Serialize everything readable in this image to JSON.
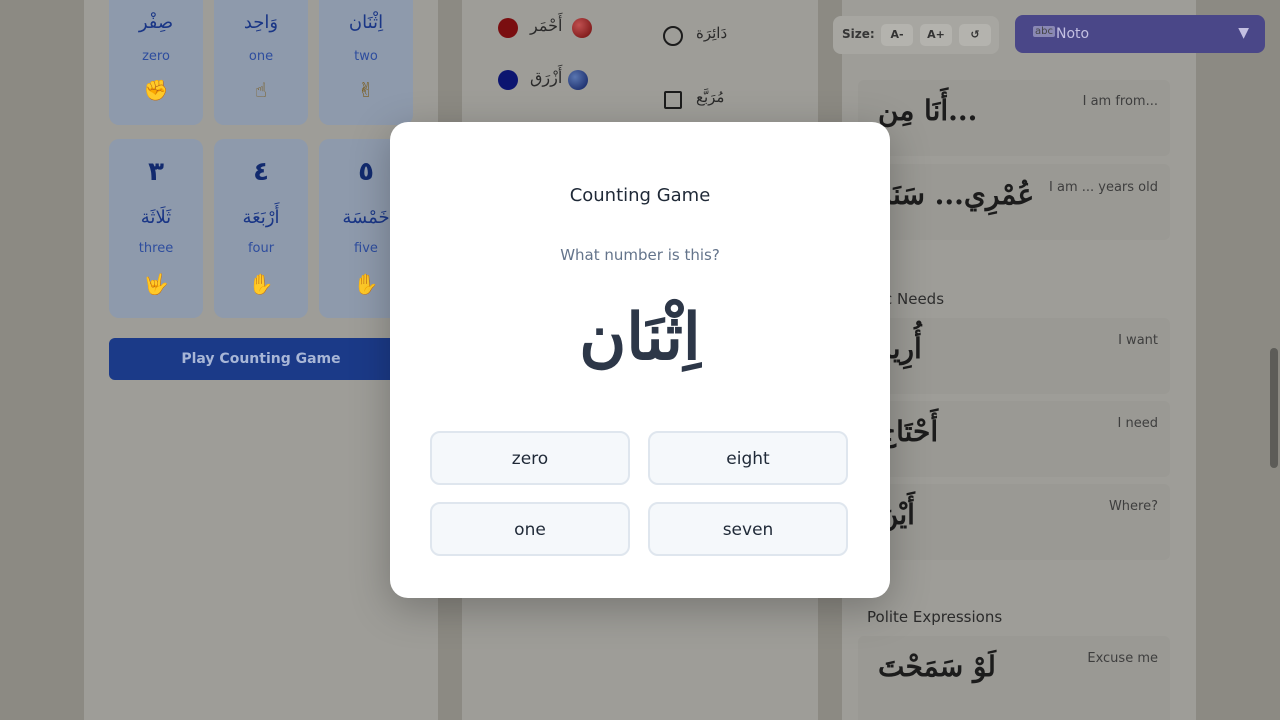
{
  "numbers": [
    {
      "ar": "صِفْر",
      "en": "zero",
      "hand": "✊"
    },
    {
      "ar": "وَاحِد",
      "en": "one",
      "hand": "☝"
    },
    {
      "ar": "اِثْنَان",
      "en": "two",
      "hand": "✌"
    },
    {
      "digit": "٣",
      "ar": "ثَلَاثَة",
      "en": "three",
      "hand": "🤟"
    },
    {
      "digit": "٤",
      "ar": "أَرْبَعَة",
      "en": "four",
      "hand": "✋"
    },
    {
      "digit": "٥",
      "ar": "خَمْسَة",
      "en": "five",
      "hand": "✋"
    }
  ],
  "play_button": "Play Counting Game",
  "colors": [
    {
      "ar": "أَحْمَر",
      "hex": "#c4161c"
    },
    {
      "ar": "أَزْرَق",
      "hex": "#1a2aa8"
    }
  ],
  "shapes": [
    {
      "ar": "دَائِرَة",
      "icon": "circle-icon"
    },
    {
      "ar": "مُرَبَّع",
      "icon": "square-icon"
    }
  ],
  "size_controls": {
    "label": "Size:",
    "decrease": "A-",
    "increase": "A+",
    "reset": "↺"
  },
  "font_select": {
    "icon": "abc",
    "value": "Noto"
  },
  "phrases": [
    {
      "ar": "أَنَا مِن...",
      "en": "I am from..."
    },
    {
      "ar": "عُمْرِي... سَنَة",
      "en": "I am ... years old"
    },
    {
      "ar": "أُرِيد",
      "en": "I want"
    },
    {
      "ar": "أَحْتَاج",
      "en": "I need"
    },
    {
      "ar": "أَيْنَ",
      "en": "Where?"
    },
    {
      "ar": "لَوْ سَمَحْتَ",
      "en": "Excuse me"
    }
  ],
  "sections": {
    "basic_needs": "sic Needs",
    "polite": "Polite Expressions"
  },
  "modal": {
    "title": "Counting Game",
    "question": "What number is this?",
    "word": "اِثْنَان",
    "options": [
      "zero",
      "eight",
      "one",
      "seven"
    ]
  }
}
